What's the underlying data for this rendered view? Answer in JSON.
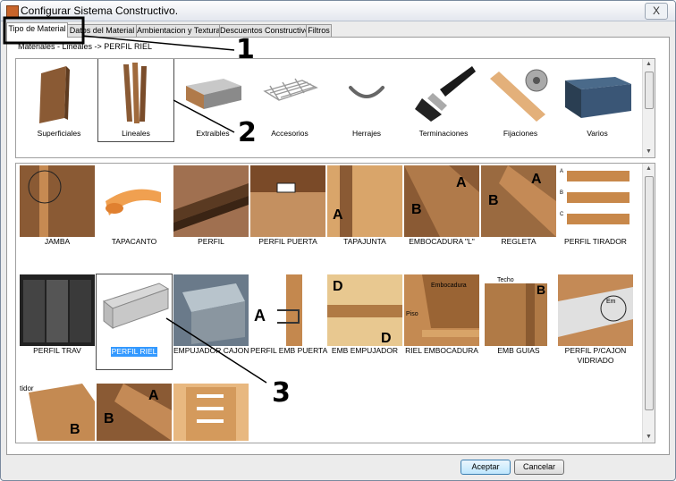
{
  "window": {
    "title": "Configurar Sistema Constructivo.",
    "close_glyph": "X"
  },
  "tabs": [
    {
      "label": "Tipo de Material"
    },
    {
      "label": "Datos del Material"
    },
    {
      "label": "Ambientacion y Texturas"
    },
    {
      "label": "Descuentos Constructivos"
    },
    {
      "label": "Filtros"
    }
  ],
  "breadcrumb": "Materiales - Lineales -> PERFIL RIEL",
  "categories": [
    {
      "label": "Superficiales",
      "icon": "panel-board-icon"
    },
    {
      "label": "Lineales",
      "icon": "wood-strips-icon",
      "selected": true
    },
    {
      "label": "Extraibles",
      "icon": "drawer-icon"
    },
    {
      "label": "Accesorios",
      "icon": "wire-rack-icon"
    },
    {
      "label": "Herrajes",
      "icon": "handle-icon"
    },
    {
      "label": "Terminaciones",
      "icon": "paintbrush-icon"
    },
    {
      "label": "Fijaciones",
      "icon": "connector-fitting-icon"
    },
    {
      "label": "Varios",
      "icon": "container-icon"
    }
  ],
  "materials": [
    {
      "label": "JAMBA"
    },
    {
      "label": "TAPACANTO"
    },
    {
      "label": "PERFIL"
    },
    {
      "label": "PERFIL PUERTA"
    },
    {
      "label": "TAPAJUNTA"
    },
    {
      "label": "EMBOCADURA \"L\""
    },
    {
      "label": "REGLETA"
    },
    {
      "label": "PERFIL TIRADOR"
    },
    {
      "label": "PERFIL TRAV"
    },
    {
      "label": "PERFIL RIEL",
      "selected": true
    },
    {
      "label": "EMPUJADOR CAJON"
    },
    {
      "label": "PERFIL EMB PUERTA"
    },
    {
      "label": "EMB EMPUJADOR"
    },
    {
      "label": "RIEL EMBOCADURA"
    },
    {
      "label": "EMB GUIAS"
    },
    {
      "label": "PERFIL P/CAJON VIDRIADO"
    },
    {
      "label": ""
    },
    {
      "label": ""
    },
    {
      "label": ""
    }
  ],
  "thumb_text": {
    "A": "A",
    "B": "B",
    "C": "C",
    "D": "D",
    "techo": "Techo",
    "em": "Em",
    "embocadura": "Embocadura",
    "piso": "Piso",
    "tidor": "tidor"
  },
  "buttons": {
    "accept": "Aceptar",
    "cancel": "Cancelar"
  },
  "annotations": {
    "n1": "1",
    "n2": "2",
    "n3": "3"
  },
  "colors": {
    "wood_dark": "#8a5a34",
    "wood_light": "#d9a56a",
    "selection": "#3399ff",
    "tapacanto": "#f0a050"
  }
}
